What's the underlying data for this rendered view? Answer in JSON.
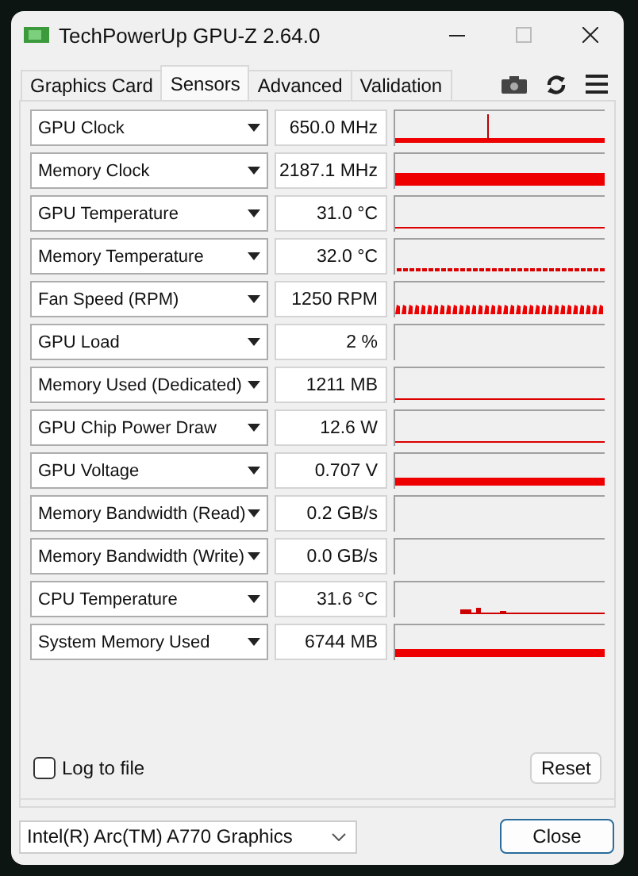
{
  "window": {
    "title": "TechPowerUp GPU-Z 2.64.0"
  },
  "tabs": [
    {
      "label": "Graphics Card",
      "selected": false
    },
    {
      "label": "Sensors",
      "selected": true
    },
    {
      "label": "Advanced",
      "selected": false
    },
    {
      "label": "Validation",
      "selected": false
    }
  ],
  "sensors": [
    {
      "name": "GPU Clock",
      "value": "650.0 MHz",
      "kind": "spike"
    },
    {
      "name": "Memory Clock",
      "value": "2187.1 MHz",
      "kind": "full"
    },
    {
      "name": "GPU Temperature",
      "value": "31.0 °C",
      "kind": "line"
    },
    {
      "name": "Memory Temperature",
      "value": "32.0 °C",
      "kind": "dotted"
    },
    {
      "name": "Fan Speed (RPM)",
      "value": "1250 RPM",
      "kind": "sawtooth"
    },
    {
      "name": "GPU Load",
      "value": "2 %",
      "kind": "empty"
    },
    {
      "name": "Memory Used (Dedicated)",
      "value": "1211 MB",
      "kind": "line"
    },
    {
      "name": "GPU Chip Power Draw",
      "value": "12.6 W",
      "kind": "line"
    },
    {
      "name": "GPU Voltage",
      "value": "0.707 V",
      "kind": "bar"
    },
    {
      "name": "Memory Bandwidth (Read)",
      "value": "0.2 GB/s",
      "kind": "empty"
    },
    {
      "name": "Memory Bandwidth (Write)",
      "value": "0.0 GB/s",
      "kind": "empty"
    },
    {
      "name": "CPU Temperature",
      "value": "31.6 °C",
      "kind": "bumps"
    },
    {
      "name": "System Memory Used",
      "value": "6744 MB",
      "kind": "bar"
    }
  ],
  "log_to_file": {
    "label": "Log to file",
    "checked": false
  },
  "reset_button": "Reset",
  "device_select": "Intel(R) Arc(TM) A770 Graphics",
  "close_button": "Close"
}
